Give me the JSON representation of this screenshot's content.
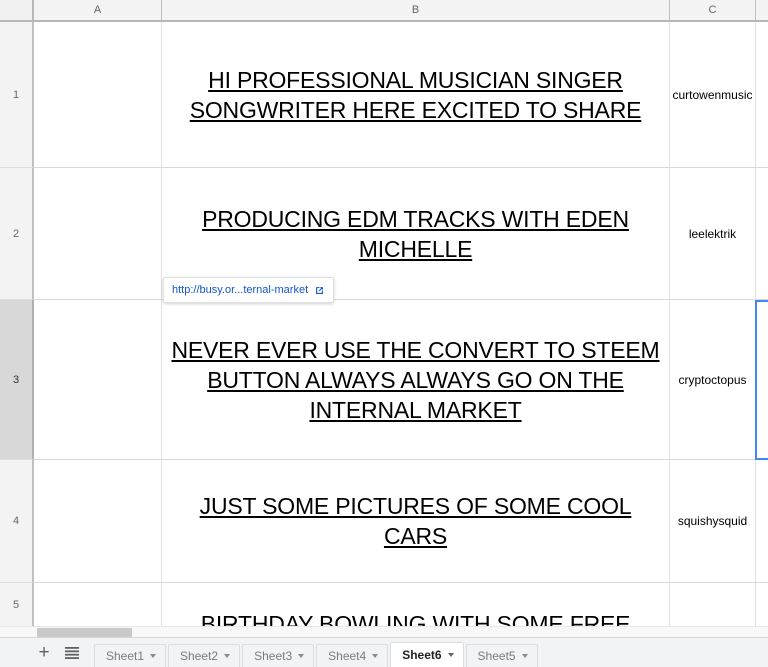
{
  "grid": {
    "columns": [
      {
        "id": "A",
        "label": "A"
      },
      {
        "id": "B",
        "label": "B"
      },
      {
        "id": "C",
        "label": "C"
      }
    ],
    "rows": [
      {
        "header": "1",
        "active": false
      },
      {
        "header": "2",
        "active": false
      },
      {
        "header": "3",
        "active": true
      },
      {
        "header": "4",
        "active": false
      },
      {
        "header": "5",
        "active": false
      }
    ],
    "cells": {
      "a1": "",
      "a2": "",
      "a3": "",
      "a4": "",
      "a5": "",
      "b1": "HI PROFESSIONAL MUSICIAN SINGER SONGWRITER HERE EXCITED TO SHARE",
      "b2": "PRODUCING EDM TRACKS WITH EDEN MICHELLE",
      "b3": "NEVER EVER USE THE CONVERT TO STEEM BUTTON ALWAYS ALWAYS GO ON THE INTERNAL MARKET",
      "b4": "JUST SOME PICTURES OF SOME COOL CARS",
      "b5": "BIRTHDAY BOWLING WITH SOME FREE",
      "c1": "curtowenmusic",
      "c2": "leelektrik",
      "c3": "cryptoctopus",
      "c4": "squishysquid",
      "c5": ""
    },
    "link_chip": {
      "text": "http://busy.or...ternal-market",
      "icon": "external-link-icon",
      "color": "#1155cc"
    },
    "selection": {
      "cell": "D3",
      "color": "#4285f4"
    }
  },
  "scrollbar": {
    "orientation": "horizontal"
  },
  "sheet_bar": {
    "add_sheet_label": "+",
    "all_sheets_label": "☰",
    "tabs": [
      {
        "label": "Sheet1",
        "active": false
      },
      {
        "label": "Sheet2",
        "active": false
      },
      {
        "label": "Sheet3",
        "active": false
      },
      {
        "label": "Sheet4",
        "active": false
      },
      {
        "label": "Sheet6",
        "active": true
      },
      {
        "label": "Sheet5",
        "active": false
      }
    ]
  }
}
